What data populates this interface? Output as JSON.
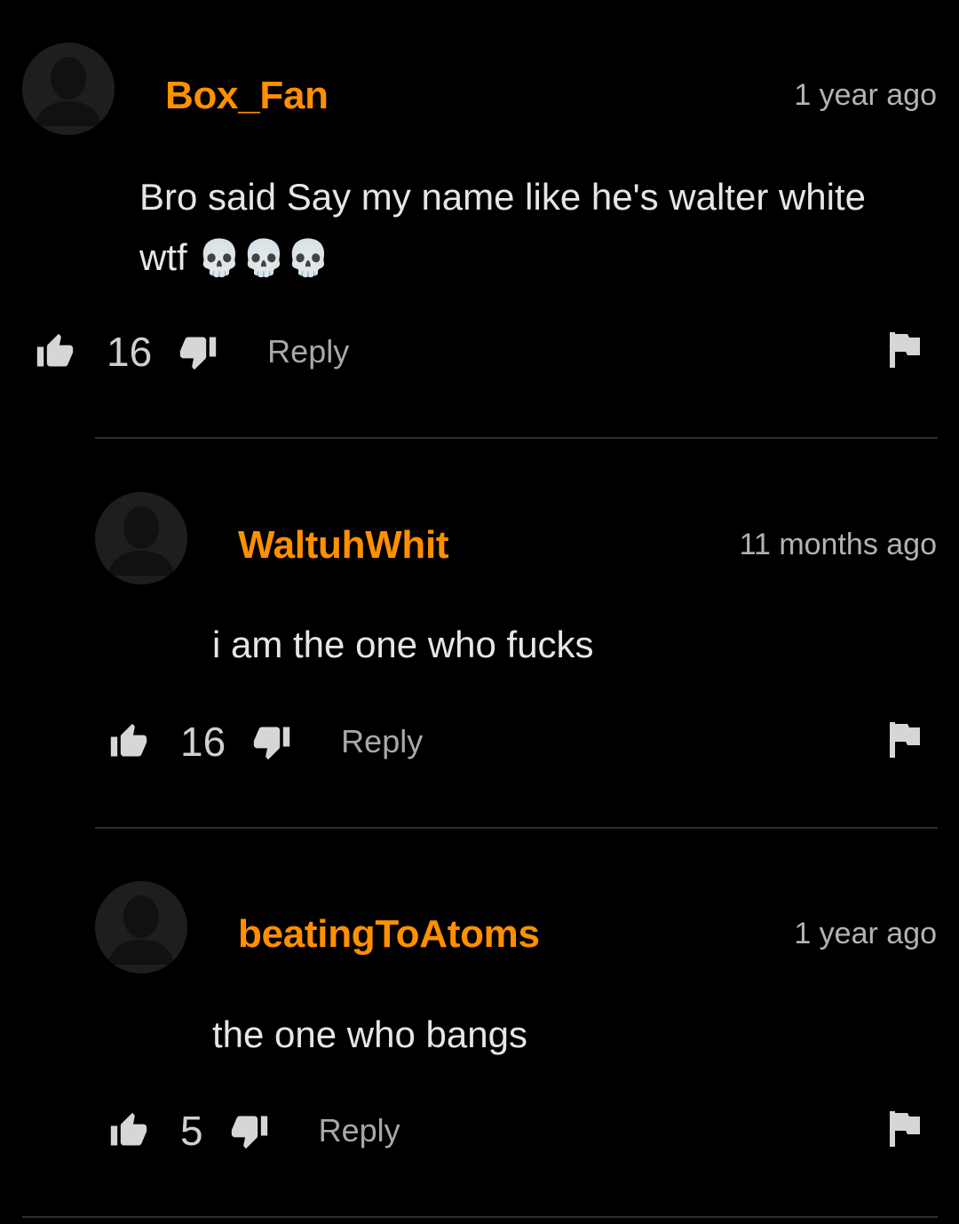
{
  "comments": [
    {
      "username": "Box_Fan",
      "timestamp": "1 year ago",
      "text_line1": "Bro said Say my name like he's walter white",
      "text_line2": "wtf",
      "emojis": "💀💀💀",
      "likes": "16",
      "reply_label": "Reply"
    },
    {
      "username": "WaltuhWhit",
      "timestamp": "11 months ago",
      "text_line1": "i am the one who fucks",
      "likes": "16",
      "reply_label": "Reply"
    },
    {
      "username": "beatingToAtoms",
      "timestamp": "1 year ago",
      "text_line1": "the one who bangs",
      "likes": "5",
      "reply_label": "Reply"
    }
  ],
  "colors": {
    "background": "#000000",
    "username": "#ff9000",
    "text": "#e6e6e6",
    "muted": "#a8a8a8"
  },
  "icons": [
    "avatar-placeholder-icon",
    "thumbs-up-icon",
    "thumbs-down-icon",
    "flag-icon"
  ]
}
